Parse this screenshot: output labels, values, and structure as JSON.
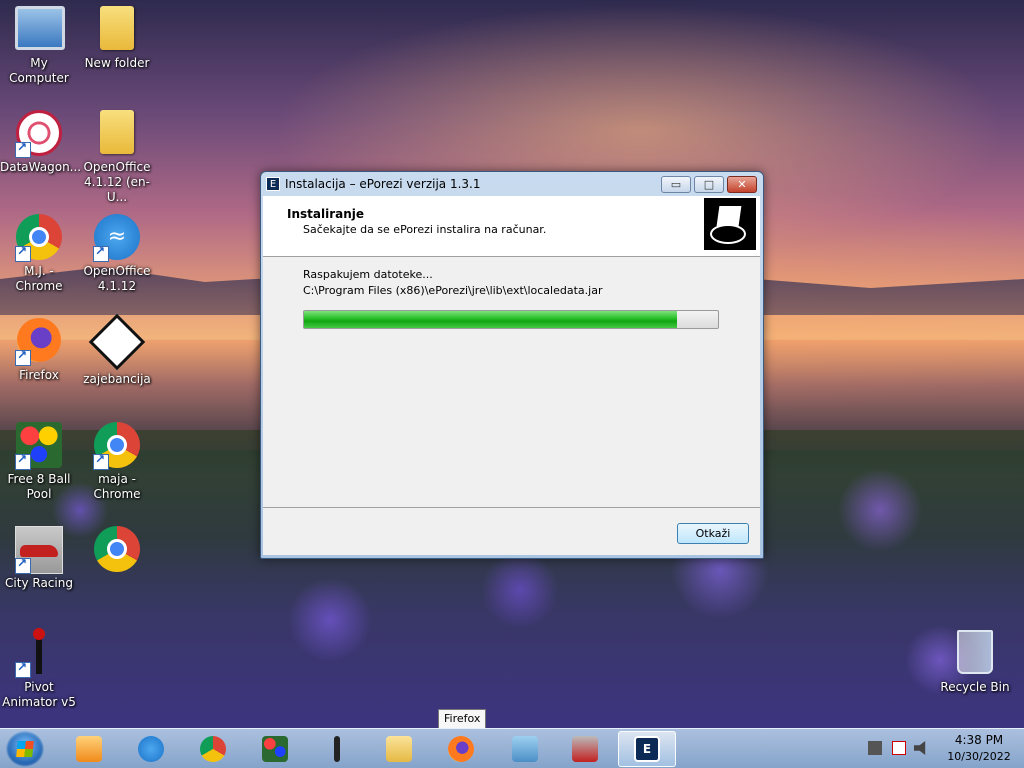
{
  "desktop": {
    "icons": {
      "my_computer": "My Computer",
      "new_folder": "New folder",
      "datawagon": "DataWagon...",
      "openoffice_en": "OpenOffice 4.1.12 (en-U...",
      "mj_chrome": "M.J. - Chrome",
      "openoffice": "OpenOffice 4.1.12",
      "firefox": "Firefox",
      "zajebancija": "zajebancija",
      "free8ball": "Free 8 Ball Pool",
      "maja_chrome": "maja - Chrome",
      "city_racing": "City Racing",
      "chrome": "",
      "pivot": "Pivot Animator v5",
      "recycle_bin": "Recycle Bin"
    }
  },
  "dialog": {
    "title": "Instalacija – ePorezi verzija 1.3.1",
    "header_title": "Instaliranje",
    "header_subtitle": "Sačekajte da se ePorezi instalira na računar.",
    "status": "Raspakujem datoteke...",
    "path": "C:\\Program Files (x86)\\ePorezi\\jre\\lib\\ext\\localedata.jar",
    "progress": 0.9,
    "cancel_label": "Otkaži",
    "buttons": {
      "minimize": "▭",
      "maximize": "□",
      "close": "✕"
    }
  },
  "tooltip": {
    "text": "Firefox"
  },
  "taskbar": {
    "time": "4:38 PM",
    "date": "10/30/2022",
    "colors": {
      "progress": "#11a611"
    }
  }
}
